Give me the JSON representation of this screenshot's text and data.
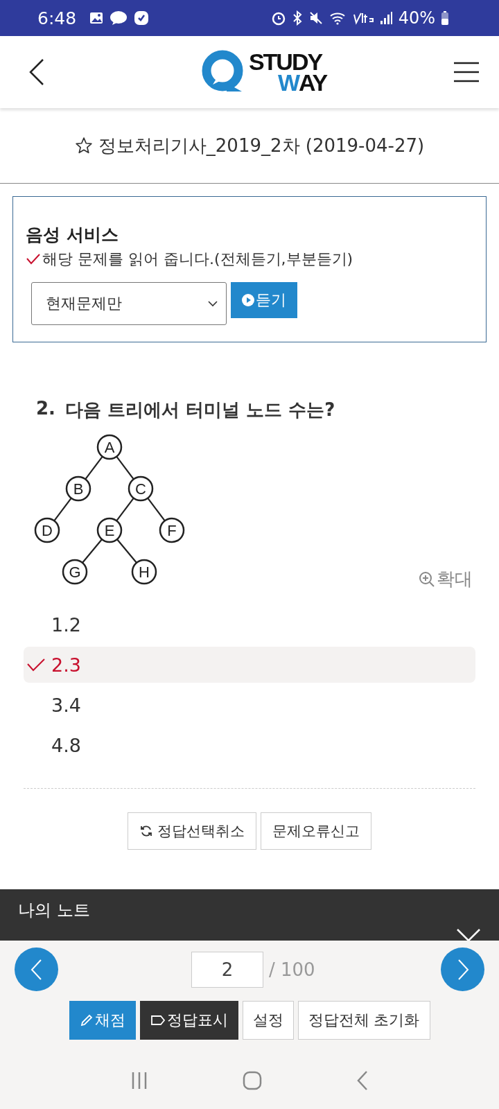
{
  "status_bar": {
    "time": "6:48",
    "battery": "40%"
  },
  "header": {
    "logo": {
      "top": "STUDY",
      "bottom_accent": "W",
      "bottom_rest": "AY"
    }
  },
  "exam_title": {
    "text": "정보처리기사_2019_2차 (2019-04-27)",
    "starred": false
  },
  "voice_service": {
    "title": "음성 서비스",
    "note": "해당 문제를 읽어 줍니다.(전체듣기,부분듣기)",
    "select_value": "현재문제만",
    "button": "듣기"
  },
  "question": {
    "number": "2.",
    "text": "다음 트리에서 터미널 노드 수는?",
    "tree": {
      "label": "A",
      "children": [
        {
          "label": "B",
          "children": [
            {
              "label": "D"
            }
          ]
        },
        {
          "label": "C",
          "children": [
            {
              "label": "E",
              "children": [
                {
                  "label": "G"
                },
                {
                  "label": "H"
                }
              ]
            },
            {
              "label": "F"
            }
          ]
        }
      ]
    },
    "zoom_link": "확대",
    "options": [
      {
        "label": "1.2",
        "selected": false
      },
      {
        "label": "2.3",
        "selected": true
      },
      {
        "label": "3.4",
        "selected": false
      },
      {
        "label": "4.8",
        "selected": false
      }
    ]
  },
  "actions": [
    {
      "kind": "reset",
      "label": "정답선택취소"
    },
    {
      "kind": "report",
      "label": "문제오류신고"
    }
  ],
  "note_panel": {
    "title": "나의 노트"
  },
  "pager": {
    "current": "2",
    "total": "/ 100"
  },
  "toolbar": [
    {
      "kind": "primary",
      "label": "채점"
    },
    {
      "kind": "dark",
      "label": "정답표시"
    },
    {
      "kind": "plain",
      "label": "설정"
    },
    {
      "kind": "plain",
      "label": "정답전체 초기화"
    }
  ]
}
